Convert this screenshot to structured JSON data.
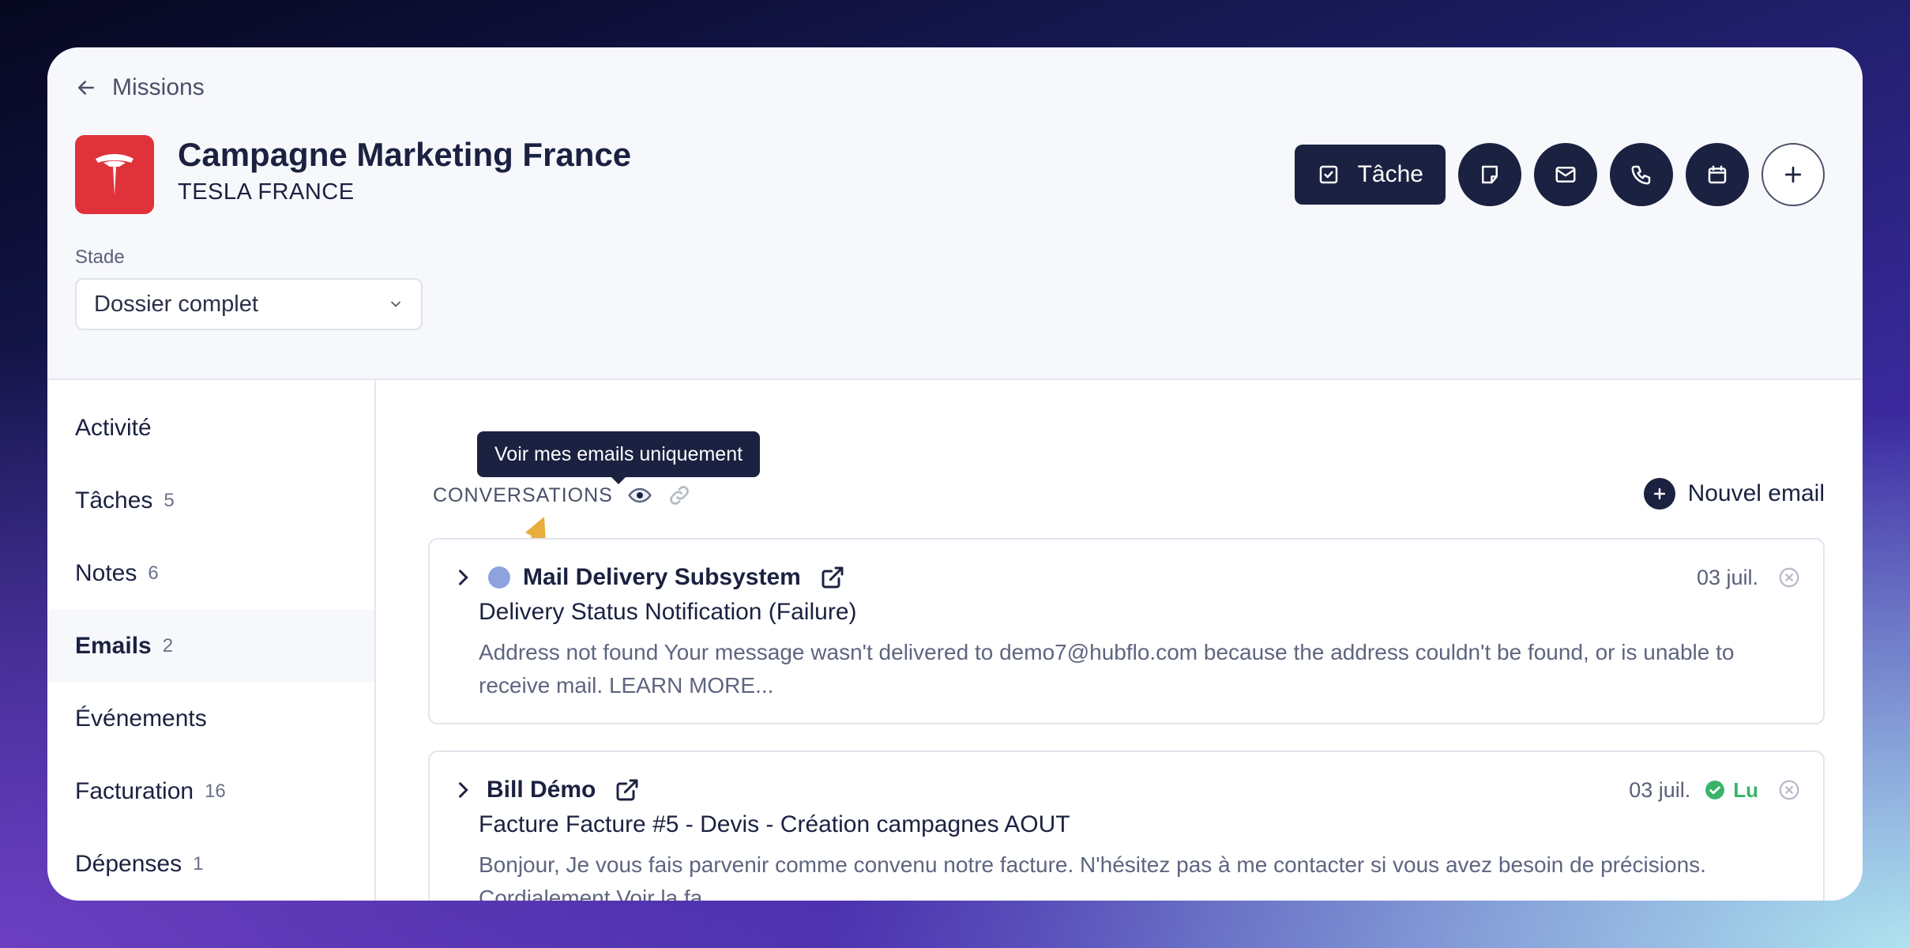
{
  "header": {
    "back_label": "Missions",
    "title": "Campagne Marketing France",
    "company": "TESLA FRANCE",
    "logo_icon": "tesla-logo",
    "brand_color": "#e0323a",
    "stade_label": "Stade",
    "stade_value": "Dossier complet"
  },
  "toolbar": {
    "task_label": "Tâche",
    "icons": [
      "checkbox-icon",
      "note-icon",
      "mail-icon",
      "phone-icon",
      "calendar-icon",
      "plus-icon"
    ]
  },
  "sidebar": {
    "items": [
      {
        "label": "Activité",
        "count": ""
      },
      {
        "label": "Tâches",
        "count": "5"
      },
      {
        "label": "Notes",
        "count": "6"
      },
      {
        "label": "Emails",
        "count": "2"
      },
      {
        "label": "Événements",
        "count": ""
      },
      {
        "label": "Facturation",
        "count": "16"
      },
      {
        "label": "Dépenses",
        "count": "1"
      }
    ],
    "active": "Emails"
  },
  "main": {
    "tooltip": "Voir mes emails uniquement",
    "conversations_label": "CONVERSATIONS",
    "new_email_label": "Nouvel email",
    "emails": [
      {
        "sender": "Mail Delivery Subsystem",
        "date": "03 juil.",
        "read_label": "",
        "subject": "Delivery Status Notification (Failure)",
        "preview": "Address not found Your message wasn't delivered to demo7@hubflo.com because the address couldn't be found, or is unable to receive mail. LEARN MORE..."
      },
      {
        "sender": "Bill Démo",
        "date": "03 juil.",
        "read_label": "Lu",
        "subject": "Facture Facture #5 - Devis - Création campagnes AOUT",
        "preview": "Bonjour, Je vous fais parvenir comme convenu notre facture. N'hésitez pas à me contacter si vous avez besoin de précisions. Cordialement Voir la fa..."
      }
    ]
  },
  "colors": {
    "navy": "#1b2140",
    "read_green": "#39b36a",
    "arrow": "#e8ad3c",
    "avatar_dot": "#8ea3de"
  }
}
